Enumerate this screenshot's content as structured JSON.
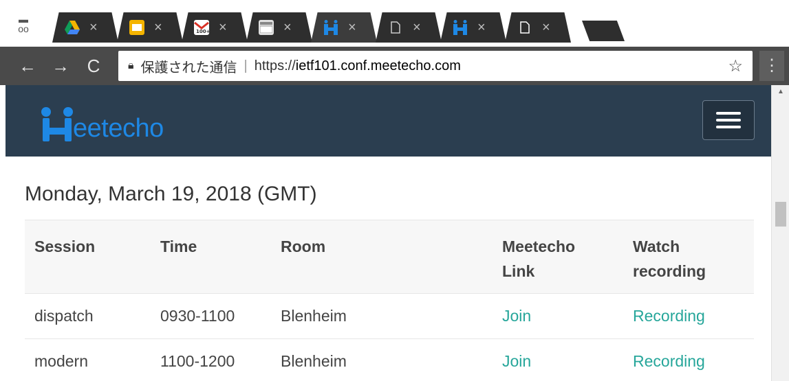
{
  "browser": {
    "tabs": [
      {
        "icon": "google-drive-icon",
        "favicon_color": "#f4b400",
        "close": "×"
      },
      {
        "icon": "google-slides-icon",
        "favicon_color": "#f4b400",
        "close": "×"
      },
      {
        "icon": "gmail-icon",
        "favicon_color": "#d93025",
        "close": "×"
      },
      {
        "icon": "calendar-icon",
        "favicon_color": "#888888",
        "close": "×"
      },
      {
        "icon": "meetecho-icon",
        "favicon_color": "#1e88e5",
        "close": "×"
      },
      {
        "icon": "document-icon",
        "favicon_color": "#cccccc",
        "close": "×"
      },
      {
        "icon": "meetecho-icon",
        "favicon_color": "#1e88e5",
        "close": "×"
      },
      {
        "icon": "document-icon",
        "favicon_color": "#ffffff",
        "close": "×"
      }
    ],
    "secure_label": "保護された通信",
    "url_scheme": "https://",
    "url_host": "ietf101.conf.meetecho.com"
  },
  "site": {
    "logo_text": "eetecho",
    "brand_color": "#1e88e5",
    "navbar_color": "#2b3e50"
  },
  "schedule": {
    "date_heading": "Monday, March 19, 2018 (GMT)",
    "headers": {
      "session": "Session",
      "time": "Time",
      "room": "Room",
      "link_line1": "Meetecho",
      "link_line2": "Link",
      "recording_line1": "Watch",
      "recording_line2": "recording"
    },
    "rows": [
      {
        "session": "dispatch",
        "time": "0930-1100",
        "room": "Blenheim",
        "link": "Join",
        "recording": "Recording"
      },
      {
        "session": "modern",
        "time": "1100-1200",
        "room": "Blenheim",
        "link": "Join",
        "recording": "Recording"
      }
    ],
    "link_color": "#26a69a"
  }
}
